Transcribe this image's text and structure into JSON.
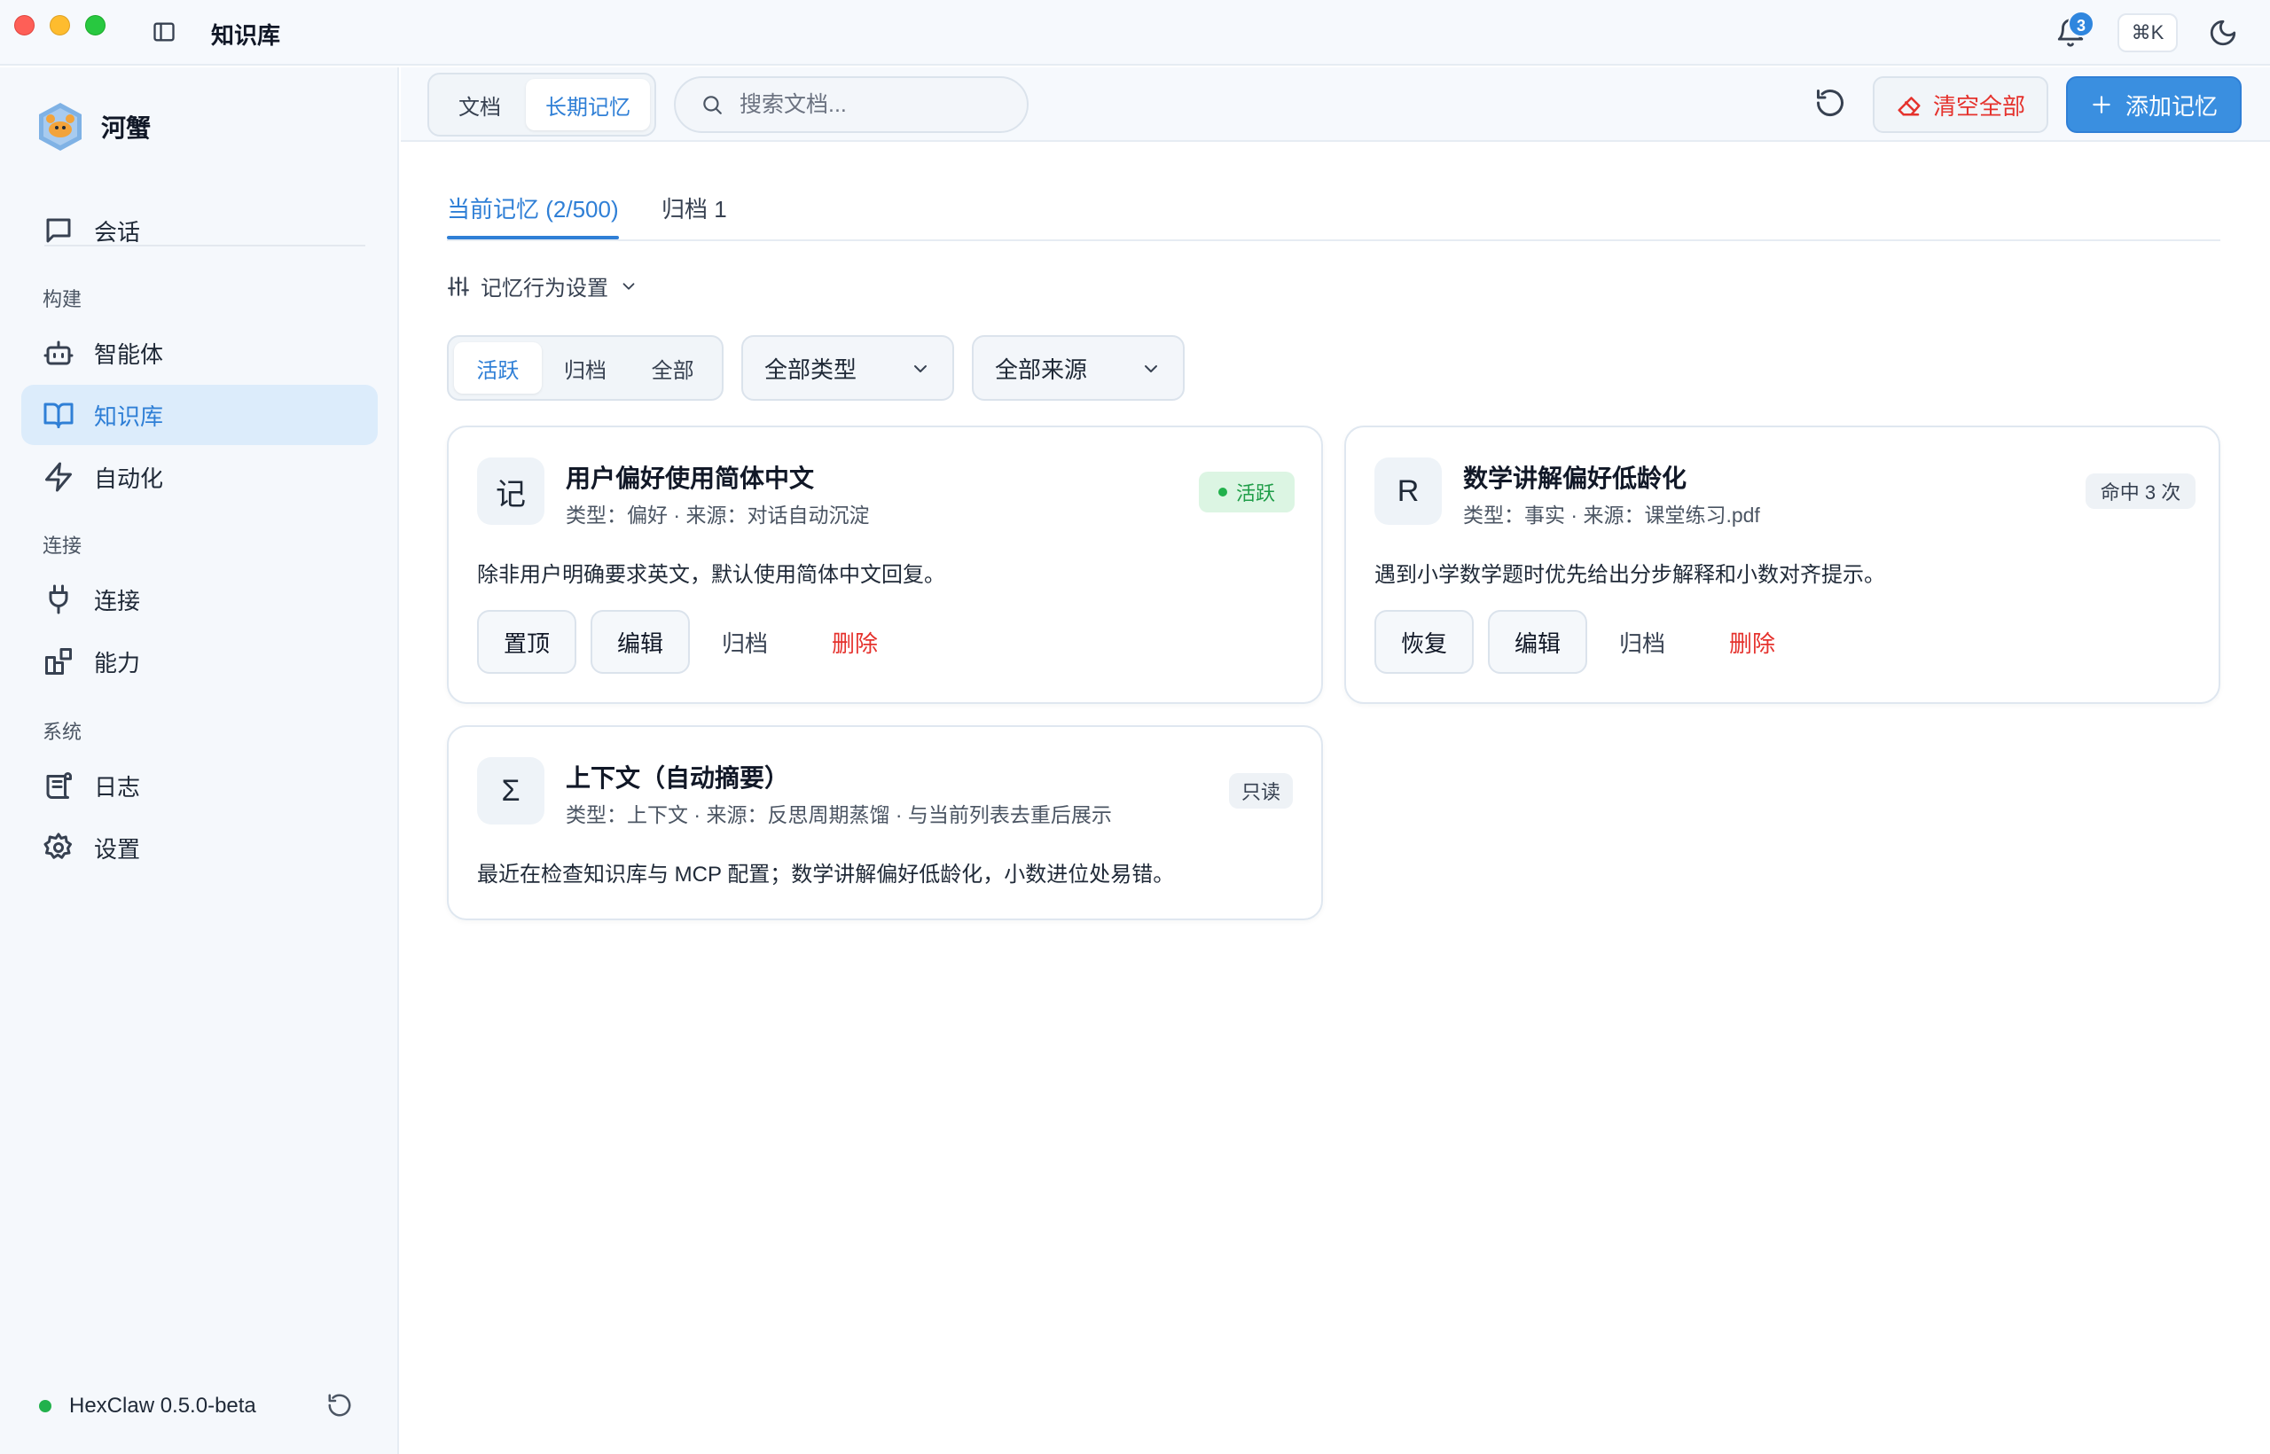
{
  "app": {
    "title": "知识库",
    "notifications": "3",
    "shortcut": "⌘K"
  },
  "sidebar": {
    "brand": "河蟹",
    "items": [
      {
        "label": "会话",
        "icon": "chat-icon"
      },
      {
        "label": "智能体",
        "icon": "robot-icon"
      },
      {
        "label": "知识库",
        "icon": "book-icon",
        "active": true
      },
      {
        "label": "自动化",
        "icon": "lightning-icon"
      },
      {
        "label": "连接",
        "icon": "plug-icon"
      },
      {
        "label": "能力",
        "icon": "blocks-icon"
      },
      {
        "label": "日志",
        "icon": "scroll-icon"
      },
      {
        "label": "设置",
        "icon": "gear-icon"
      }
    ],
    "sections": [
      "构建",
      "连接",
      "系统"
    ],
    "version": "HexClaw 0.5.0-beta"
  },
  "toolbar": {
    "tabs": [
      "文档",
      "长期记忆"
    ],
    "active_tab": "长期记忆",
    "search_placeholder": "搜索文档...",
    "clear_label": "清空全部",
    "add_label": "添加记忆"
  },
  "main": {
    "tabs": [
      "当前记忆 (2/500)",
      "归档 1"
    ],
    "behavior_label": "记忆行为设置",
    "status_filters": [
      "活跃",
      "归档",
      "全部"
    ],
    "type_filter": "全部类型",
    "source_filter": "全部来源",
    "cards": [
      {
        "avatar": "记",
        "title": "用户偏好使用简体中文",
        "meta": "类型：偏好 · 来源：对话自动沉淀",
        "badge": "活跃",
        "body": "除非用户明确要求英文，默认使用简体中文回复。",
        "actions": [
          "置顶",
          "编辑",
          "归档",
          "删除"
        ]
      },
      {
        "avatar": "R",
        "title": "数学讲解偏好低龄化",
        "meta": "类型：事实 · 来源：课堂练习.pdf",
        "badge": "命中 3 次",
        "body": "遇到小学数学题时优先给出分步解释和小数对齐提示。",
        "actions": [
          "恢复",
          "编辑",
          "归档",
          "删除"
        ]
      },
      {
        "avatar": "Σ",
        "title": "上下文（自动摘要）",
        "meta": "类型：上下文 · 来源：反思周期蒸馏 · 与当前列表去重后展示",
        "badge": "只读",
        "body": "最近在检查知识库与 MCP 配置；数学讲解偏好低龄化，小数进位处易错。"
      }
    ]
  },
  "colors": {
    "accent": "#2f7fd6",
    "danger": "#e5322d",
    "success": "#22b14c"
  }
}
